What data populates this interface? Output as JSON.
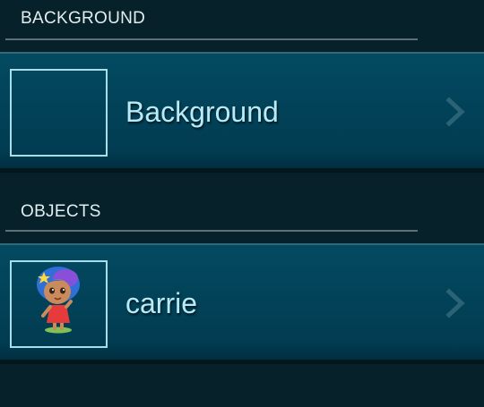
{
  "background_section": {
    "title": "BACKGROUND",
    "item": {
      "name": "Background",
      "icon": "chevron-right-icon"
    }
  },
  "objects_section": {
    "title": "OBJECTS",
    "items": [
      {
        "name": "carrie",
        "thumbnail": "character-sprite",
        "icon": "chevron-right-icon"
      }
    ]
  },
  "colors": {
    "app_background": "#062129",
    "row_background": "#034a61",
    "label_text": "#b8ebf6",
    "thumb_border": "#a9dde9"
  }
}
